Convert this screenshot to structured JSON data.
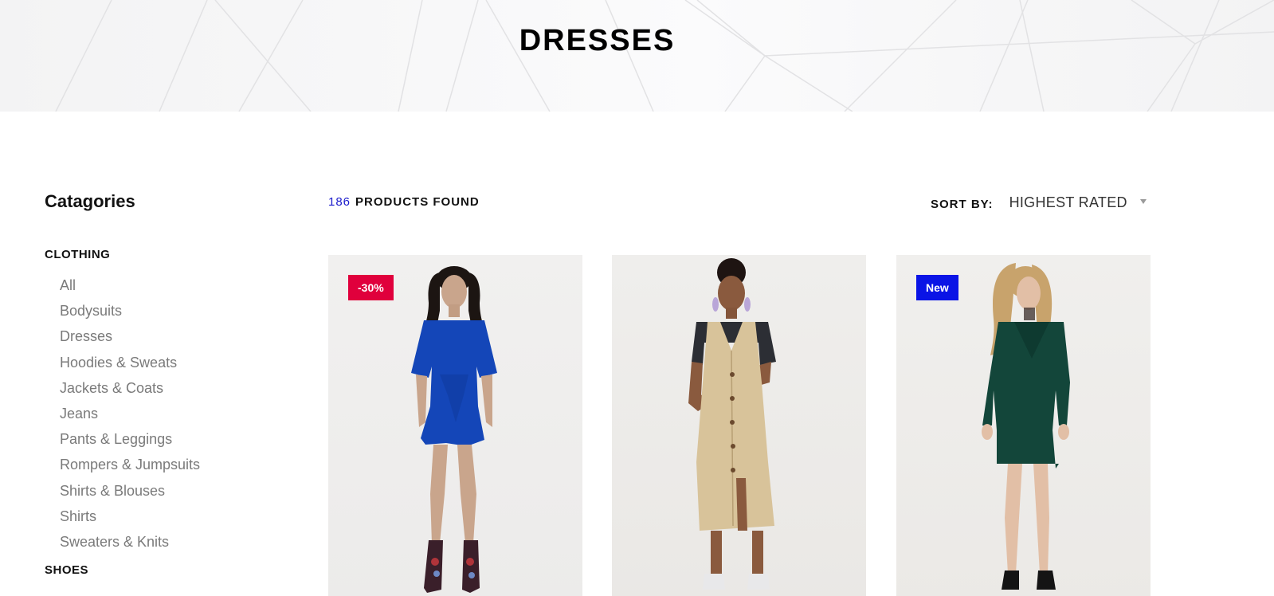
{
  "hero": {
    "title": "DRESSES"
  },
  "sidebar": {
    "title": "Catagories",
    "groups": [
      {
        "title": "CLOTHING",
        "items": [
          "All",
          "Bodysuits",
          "Dresses",
          "Hoodies & Sweats",
          "Jackets & Coats",
          "Jeans",
          "Pants & Leggings",
          "Rompers & Jumpsuits",
          "Shirts & Blouses",
          "Shirts",
          "Sweaters & Knits"
        ]
      },
      {
        "title": "SHOES",
        "items": []
      }
    ]
  },
  "toolbar": {
    "count": "186",
    "found_label": "PRODUCTS FOUND",
    "sort_label": "SORT BY:",
    "sort_value": "HIGHEST RATED"
  },
  "products": [
    {
      "badge": "-30%",
      "badge_type": "sale",
      "dress_color": "#1446b8"
    },
    {
      "badge": "",
      "badge_type": "",
      "dress_color": "#d8c39a"
    },
    {
      "badge": "New",
      "badge_type": "new",
      "dress_color": "#13463a"
    }
  ],
  "colors": {
    "accent_blue": "#1a1acc",
    "sale_badge": "#e0003c",
    "new_badge": "#0a14e6",
    "category_text": "#7a7a7a"
  }
}
